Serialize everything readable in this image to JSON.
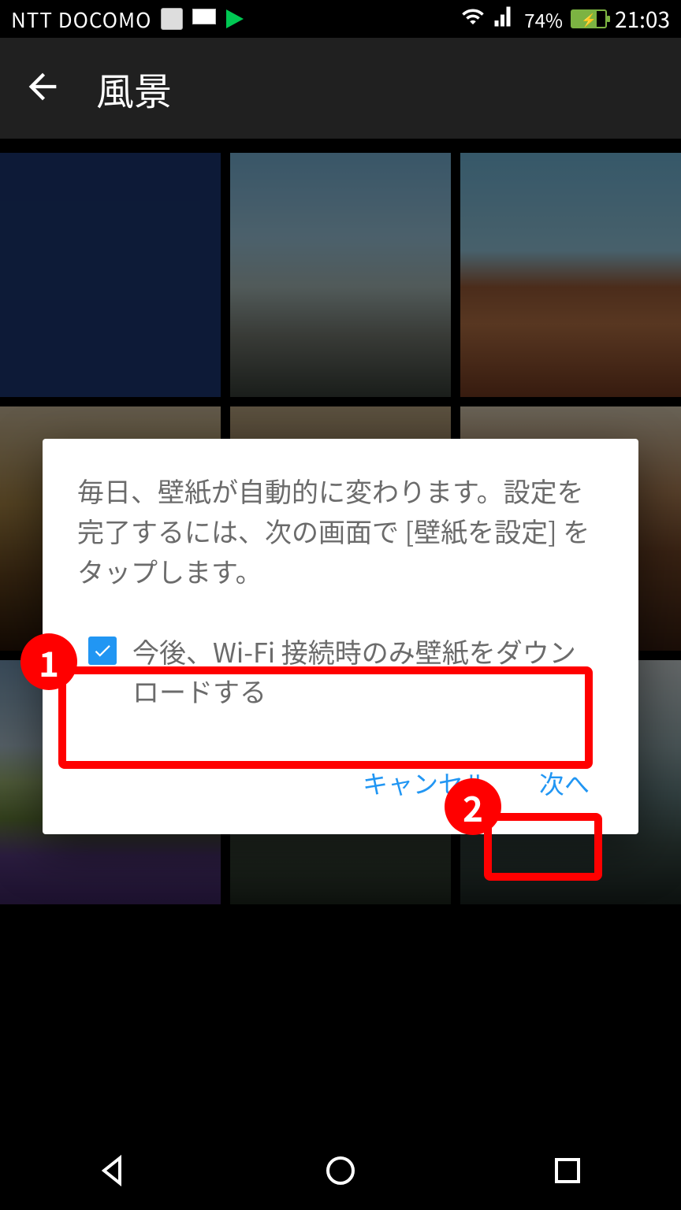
{
  "status": {
    "carrier": "NTT DOCOMO",
    "battery_pct": "74%",
    "clock": "21:03"
  },
  "header": {
    "title": "風景"
  },
  "dialog": {
    "message": "毎日、壁紙が自動的に変わります。設定を完了するには、次の画面で [壁紙を設定] をタップします。",
    "checkbox_label": "今後、Wi-Fi 接続時のみ壁紙をダウンロードする",
    "checkbox_checked": true,
    "cancel_label": "キャンセル",
    "next_label": "次へ"
  },
  "annotations": {
    "badge1": "1",
    "badge2": "2"
  }
}
